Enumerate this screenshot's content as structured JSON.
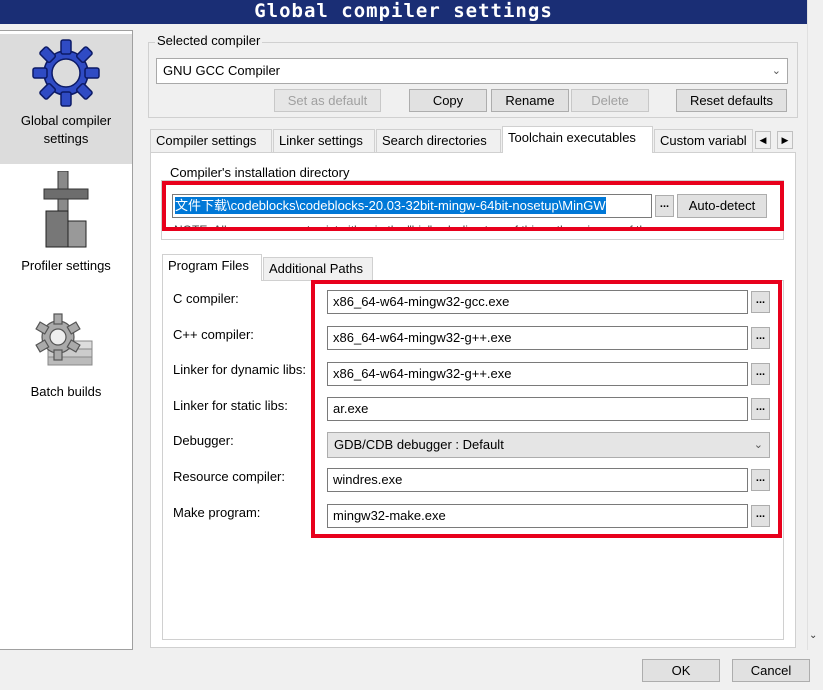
{
  "window": {
    "title": "Global compiler settings"
  },
  "sidebar": {
    "items": [
      {
        "label_line1": "Global compiler",
        "label_line2": "settings",
        "icon": "gear-icon"
      },
      {
        "label": "Profiler settings",
        "icon": "caliper-icon"
      },
      {
        "label": "Batch builds",
        "icon": "batch-gear-icon"
      }
    ]
  },
  "selected_compiler": {
    "group_label": "Selected compiler",
    "value": "GNU GCC Compiler",
    "buttons": {
      "set_default": "Set as default",
      "copy": "Copy",
      "rename": "Rename",
      "delete": "Delete",
      "reset": "Reset defaults"
    }
  },
  "tabs": [
    {
      "label": "Compiler settings"
    },
    {
      "label": "Linker settings"
    },
    {
      "label": "Search directories"
    },
    {
      "label": "Toolchain executables"
    },
    {
      "label": "Custom variabl"
    }
  ],
  "install_dir": {
    "group_label": "Compiler's installation directory",
    "value": "文件下载\\codeblocks\\codeblocks-20.03-32bit-mingw-64bit-nosetup\\MinGW",
    "browse": "...",
    "auto_detect": "Auto-detect",
    "note": "NOTE: All programs must exist either in the \"bin\" sub-directory of this path, or in any of the"
  },
  "subtabs": [
    {
      "label": "Program Files"
    },
    {
      "label": "Additional Paths"
    }
  ],
  "program_files": [
    {
      "label": "C compiler:",
      "value": "x86_64-w64-mingw32-gcc.exe"
    },
    {
      "label": "C++ compiler:",
      "value": "x86_64-w64-mingw32-g++.exe"
    },
    {
      "label": "Linker for dynamic libs:",
      "value": "x86_64-w64-mingw32-g++.exe"
    },
    {
      "label": "Linker for static libs:",
      "value": "ar.exe"
    },
    {
      "label": "Debugger:",
      "value": "GDB/CDB debugger : Default"
    },
    {
      "label": "Resource compiler:",
      "value": "windres.exe"
    },
    {
      "label": "Make program:",
      "value": "mingw32-make.exe"
    }
  ],
  "browse_label": "...",
  "dialog_buttons": {
    "ok": "OK",
    "cancel": "Cancel"
  },
  "colors": {
    "titlebar": "#1a2e75",
    "highlight": "#e8001c",
    "selection": "#0078d7"
  }
}
